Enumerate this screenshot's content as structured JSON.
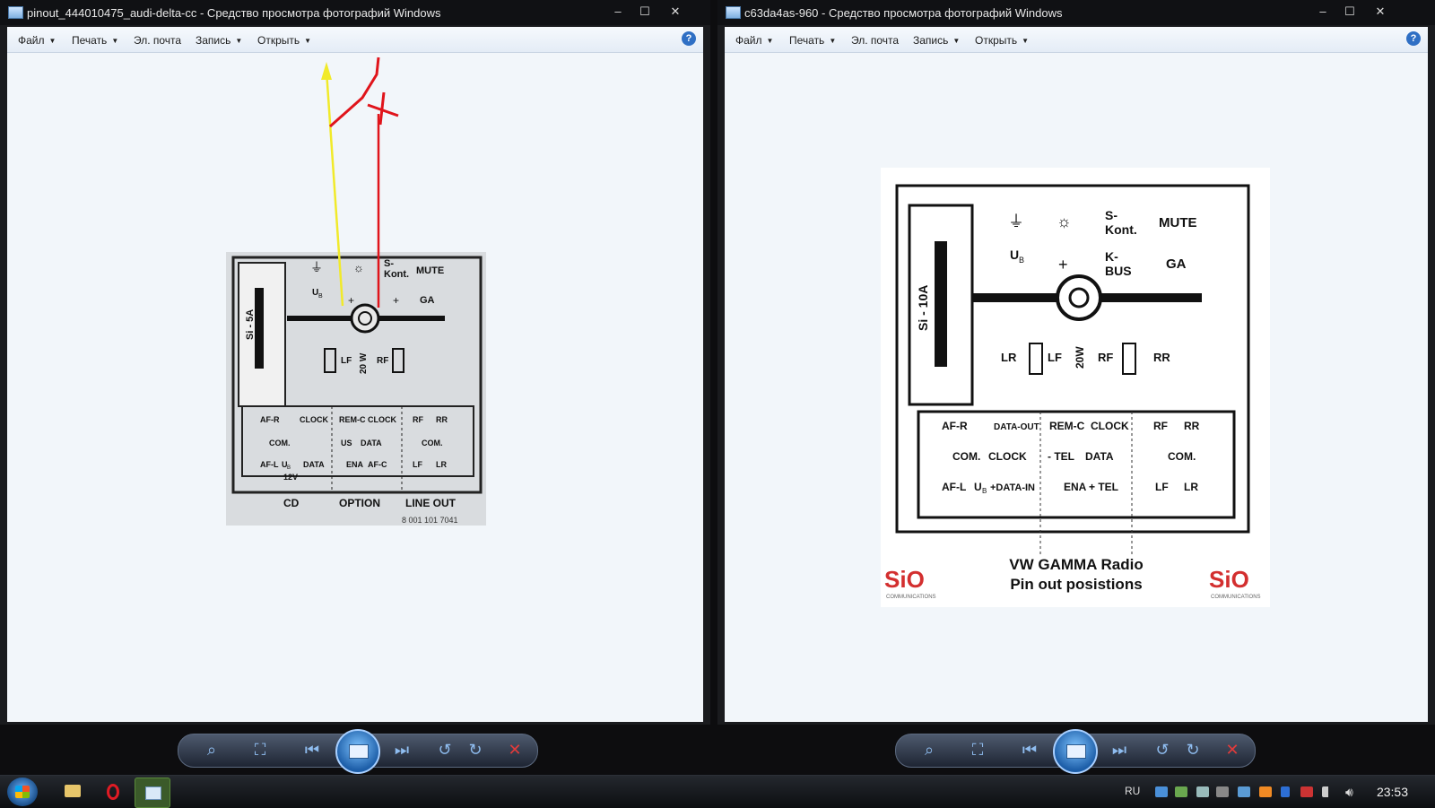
{
  "left_window": {
    "title": "pinout_444010475_audi-delta-cc - Средство просмотра фотографий Windows",
    "menu": [
      "Файл",
      "Печать",
      "Эл. почта",
      "Запись",
      "Открыть"
    ],
    "image": {
      "fuse": "Si - 5A",
      "top_pins": [
        "Kont.",
        "MUTE",
        "GA"
      ],
      "top_pin_label_s": "S-",
      "ub": "U",
      "ub_sub": "B",
      "speakers": [
        "LF",
        "RF"
      ],
      "power": "20 W",
      "cd_block": [
        "AF-R",
        "CLOCK",
        "COM.",
        "AF-L",
        "DATA",
        "12V",
        "U",
        "B"
      ],
      "option_block": [
        "REM-C",
        "CLOCK",
        "US",
        "DATA",
        "ENA",
        "AF-C"
      ],
      "lineout_block": [
        "RF",
        "RR",
        "COM.",
        "LF",
        "LR"
      ],
      "sections": [
        "CD",
        "OPTION",
        "LINE OUT"
      ],
      "part_number": "8 001 101 7041"
    }
  },
  "right_window": {
    "title": "c63da4as-960 - Средство просмотра фотографий Windows",
    "menu": [
      "Файл",
      "Печать",
      "Эл. почта",
      "Запись",
      "Открыть"
    ],
    "image": {
      "fuse": "Si - 10A",
      "pins_row1": [
        "S-",
        "Kont.",
        "MUTE"
      ],
      "pins_row2": [
        "U",
        "B",
        "K-",
        "BUS",
        "GA"
      ],
      "speakers": [
        "LR",
        "LF",
        "20W",
        "RF",
        "RR"
      ],
      "block1": [
        "AF-R",
        "DATA-OUT",
        "COM.",
        "CLOCK",
        "AF-L",
        "U",
        "B",
        "+DATA-IN"
      ],
      "block2": [
        "REM-C",
        "CLOCK",
        "- TEL",
        "DATA",
        "ENA",
        "+ TEL"
      ],
      "block3": [
        "RF",
        "RR",
        "COM.",
        "LF",
        "LR"
      ],
      "caption_line1": "VW GAMMA Radio",
      "caption_line2": "Pin out posistions",
      "logo": "SiO",
      "logo_sub": "COMMUNICATIONS"
    }
  },
  "help_label": "?",
  "taskbar": {
    "language": "RU",
    "time": "23:53"
  },
  "colors": {
    "arrow_yellow": "#f1ea2a",
    "arrow_red": "#e0141b",
    "logo_red": "#d32f2f"
  }
}
